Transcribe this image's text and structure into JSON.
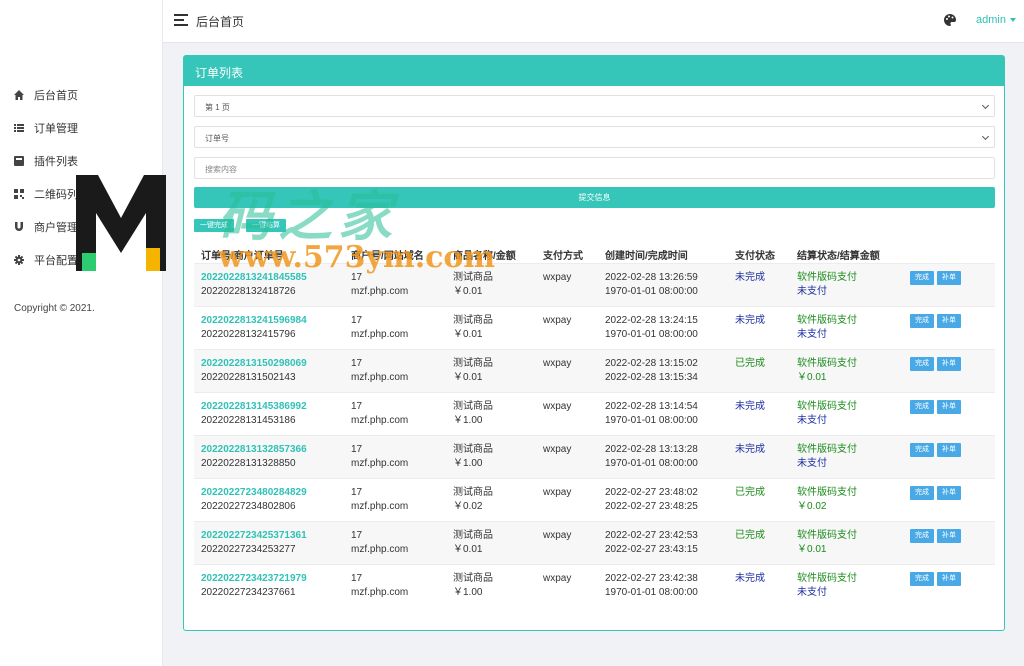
{
  "sidebar": {
    "items": [
      {
        "label": "后台首页",
        "icon": "home-icon"
      },
      {
        "label": "订单管理",
        "icon": "list-icon"
      },
      {
        "label": "插件列表",
        "icon": "plugin-icon"
      },
      {
        "label": "二维码列表",
        "icon": "qrcode-icon"
      },
      {
        "label": "商户管理",
        "icon": "magnet-icon"
      },
      {
        "label": "平台配置",
        "icon": "gear-icon"
      }
    ],
    "copyright": "Copyright © 2021."
  },
  "header": {
    "title": "后台首页",
    "user": "admin"
  },
  "panel": {
    "title": "订单列表",
    "page_select": "第 1 页",
    "field_select": "订单号",
    "search_placeholder": "搜索内容",
    "submit_label": "提交信息",
    "btn_one_key_complete": "一键完成",
    "btn_one_key_settle": "一键结算"
  },
  "table": {
    "headers": [
      "订单号/商户订单号",
      "商户号/网站域名",
      "商品名称/金额",
      "支付方式",
      "创建时间/完成时间",
      "支付状态",
      "结算状态/结算金额"
    ],
    "rows": [
      {
        "order": "2022022813241845585",
        "merchant_order": "20220228132418726",
        "mid": "17",
        "domain": "mzf.php.com",
        "product": "测试商品",
        "amount": "￥0.01",
        "method": "wxpay",
        "created": "2022-02-28 13:26:59",
        "finished": "1970-01-01 08:00:00",
        "pay_status": "未完成",
        "settle": "软件版码支付",
        "settle_amount": "未支付"
      },
      {
        "order": "2022022813241596984",
        "merchant_order": "20220228132415796",
        "mid": "17",
        "domain": "mzf.php.com",
        "product": "测试商品",
        "amount": "￥0.01",
        "method": "wxpay",
        "created": "2022-02-28 13:24:15",
        "finished": "1970-01-01 08:00:00",
        "pay_status": "未完成",
        "settle": "软件版码支付",
        "settle_amount": "未支付"
      },
      {
        "order": "2022022813150298069",
        "merchant_order": "20220228131502143",
        "mid": "17",
        "domain": "mzf.php.com",
        "product": "测试商品",
        "amount": "￥0.01",
        "method": "wxpay",
        "created": "2022-02-28 13:15:02",
        "finished": "2022-02-28 13:15:34",
        "pay_status": "已完成",
        "settle": "软件版码支付",
        "settle_amount": "￥0.01"
      },
      {
        "order": "2022022813145386992",
        "merchant_order": "20220228131453186",
        "mid": "17",
        "domain": "mzf.php.com",
        "product": "测试商品",
        "amount": "￥1.00",
        "method": "wxpay",
        "created": "2022-02-28 13:14:54",
        "finished": "1970-01-01 08:00:00",
        "pay_status": "未完成",
        "settle": "软件版码支付",
        "settle_amount": "未支付"
      },
      {
        "order": "2022022813132857366",
        "merchant_order": "20220228131328850",
        "mid": "17",
        "domain": "mzf.php.com",
        "product": "测试商品",
        "amount": "￥1.00",
        "method": "wxpay",
        "created": "2022-02-28 13:13:28",
        "finished": "1970-01-01 08:00:00",
        "pay_status": "未完成",
        "settle": "软件版码支付",
        "settle_amount": "未支付"
      },
      {
        "order": "2022022723480284829",
        "merchant_order": "20220227234802806",
        "mid": "17",
        "domain": "mzf.php.com",
        "product": "测试商品",
        "amount": "￥0.02",
        "method": "wxpay",
        "created": "2022-02-27 23:48:02",
        "finished": "2022-02-27 23:48:25",
        "pay_status": "已完成",
        "settle": "软件版码支付",
        "settle_amount": "￥0.02"
      },
      {
        "order": "2022022723425371361",
        "merchant_order": "20220227234253277",
        "mid": "17",
        "domain": "mzf.php.com",
        "product": "测试商品",
        "amount": "￥0.01",
        "method": "wxpay",
        "created": "2022-02-27 23:42:53",
        "finished": "2022-02-27 23:43:15",
        "pay_status": "已完成",
        "settle": "软件版码支付",
        "settle_amount": "￥0.01"
      },
      {
        "order": "2022022723423721979",
        "merchant_order": "20220227234237661",
        "mid": "17",
        "domain": "mzf.php.com",
        "product": "测试商品",
        "amount": "￥1.00",
        "method": "wxpay",
        "created": "2022-02-27 23:42:38",
        "finished": "1970-01-01 08:00:00",
        "pay_status": "未完成",
        "settle": "软件版码支付",
        "settle_amount": "未支付"
      }
    ],
    "btn_complete": "完成",
    "btn_resend": "补单"
  },
  "watermark": {
    "text": "码之家",
    "url": "www.573ym.com"
  },
  "colors": {
    "accent": "#36c6b9",
    "action_button": "#48a9e6",
    "status_incomplete": "#1c2fa0",
    "status_complete": "#1a8a1a"
  }
}
